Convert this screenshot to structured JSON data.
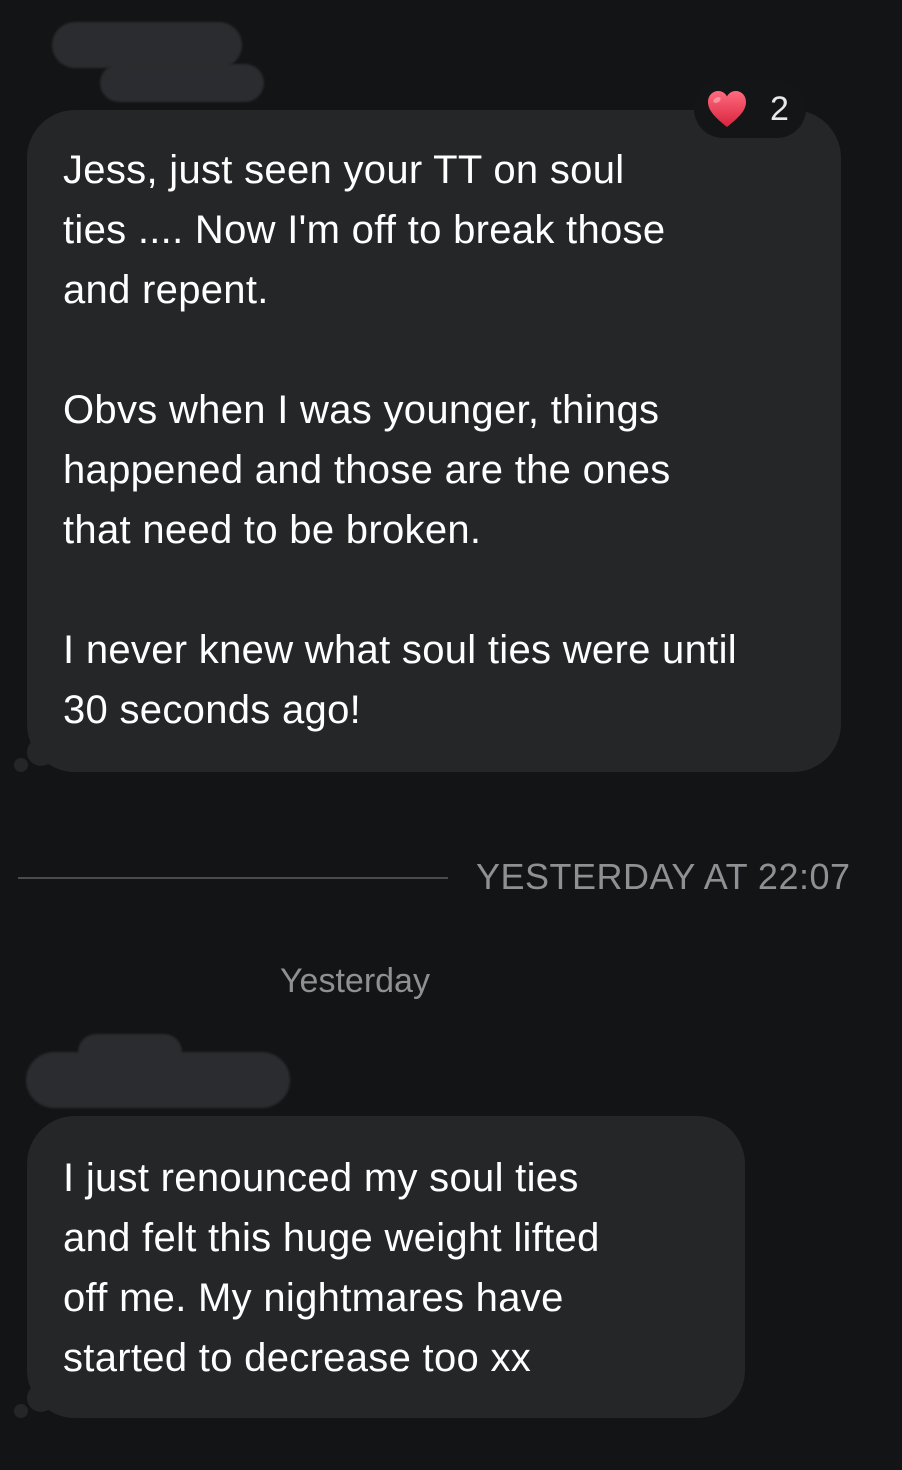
{
  "conversation": {
    "messages": [
      {
        "text": "Jess, just seen your TT on soul\nties .... Now I'm off to break those\nand repent.\n\nObvs when I was younger, things\nhappened and those are the ones\nthat need to be broken.\n\nI never knew what soul ties were until\n30 seconds ago!",
        "reaction": {
          "icon": "heart-icon",
          "color": "#e8435a",
          "count": "2"
        }
      },
      {
        "text": "I just renounced my soul ties\nand felt this huge weight lifted\noff me. My nightmares have\nstarted to decrease too xx"
      }
    ],
    "divider_timestamp": "YESTERDAY AT 22:07",
    "day_label": "Yesterday"
  },
  "colors": {
    "background": "#131416",
    "bubble": "#252628",
    "muted_text": "#8f9094"
  }
}
